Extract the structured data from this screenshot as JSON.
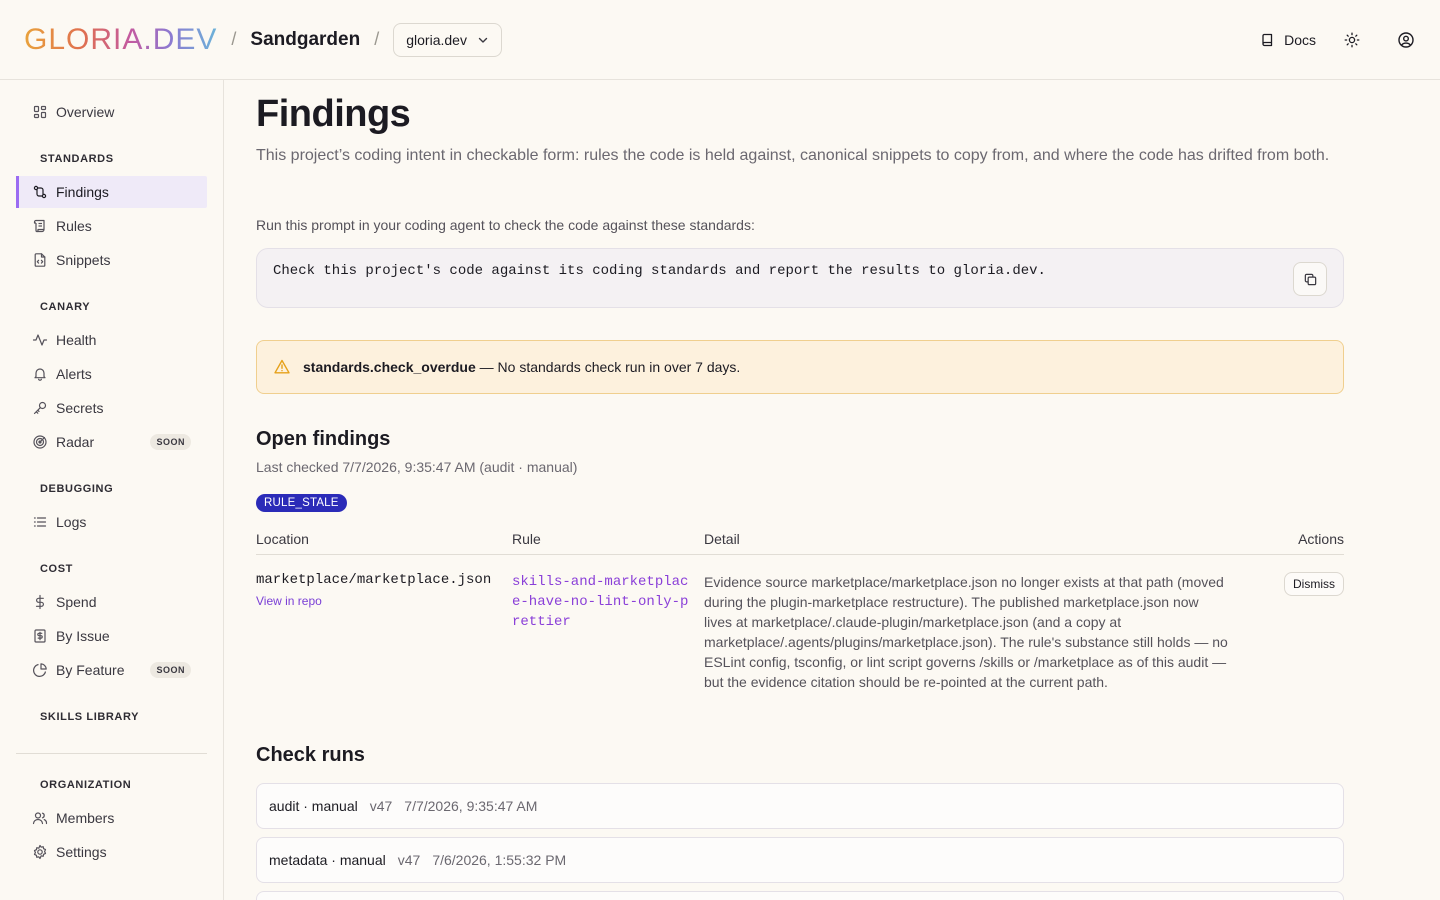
{
  "header": {
    "logo": "GLORIA.DEV",
    "separator": "/",
    "project": "Sandgarden",
    "org_select": "gloria.dev",
    "docs_label": "Docs"
  },
  "sidebar": {
    "overview": "Overview",
    "standards": {
      "label": "STANDARDS",
      "items": [
        "Findings",
        "Rules",
        "Snippets"
      ]
    },
    "canary": {
      "label": "CANARY",
      "items": [
        "Health",
        "Alerts",
        "Secrets",
        "Radar"
      ],
      "radar_badge": "SOON"
    },
    "debugging": {
      "label": "DEBUGGING",
      "items": [
        "Logs"
      ]
    },
    "cost": {
      "label": "COST",
      "items": [
        "Spend",
        "By Issue",
        "By Feature"
      ],
      "feature_badge": "SOON"
    },
    "skills_library": "SKILLS LIBRARY",
    "organization": {
      "label": "ORGANIZATION",
      "items": [
        "Members",
        "Settings"
      ]
    }
  },
  "main": {
    "title": "Findings",
    "description": "This project’s coding intent in checkable form: rules the code is held against, canonical snippets to copy from, and where the code has drifted from both.",
    "prompt_hint": "Run this prompt in your coding agent to check the code against these standards:",
    "prompt_text": "Check this project's code against its coding standards and report the results to gloria.dev.",
    "alert": {
      "code": "standards.check_overdue",
      "message": " — No standards check run in over 7 days."
    },
    "open_findings": {
      "title": "Open findings",
      "last_checked": "Last checked 7/7/2026, 9:35:47 AM (audit · manual)",
      "badge": "RULE_STALE",
      "columns": [
        "Location",
        "Rule",
        "Detail",
        "Actions"
      ],
      "rows": [
        {
          "location": "marketplace/marketplace.json",
          "repo_link": "View in repo",
          "rule": "skills-and-marketplace-have-no-lint-only-prettier",
          "detail": "Evidence source marketplace/marketplace.json no longer exists at that path (moved during the plugin-marketplace restructure). The published marketplace.json now lives at marketplace/.claude-plugin/marketplace.json (and a copy at marketplace/.agents/plugins/marketplace.json). The rule's substance still holds — no ESLint config, tsconfig, or lint script governs /skills or /marketplace as of this audit — but the evidence citation should be re-pointed at the current path.",
          "action": "Dismiss"
        }
      ]
    },
    "check_runs": {
      "title": "Check runs",
      "runs": [
        {
          "name": "audit · manual",
          "version": "v47",
          "time": "7/7/2026, 9:35:47 AM"
        },
        {
          "name": "metadata · manual",
          "version": "v47",
          "time": "7/6/2026, 1:55:32 PM"
        }
      ]
    }
  },
  "colors": {
    "accent": "#9b6cf2",
    "badge": "#2b2bb8",
    "alert_bg": "#fdf1dd",
    "alert_border": "#f0cf8e",
    "link": "#8a3fd8"
  }
}
